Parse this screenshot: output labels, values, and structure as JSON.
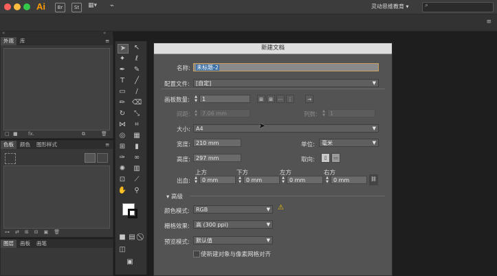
{
  "app": {
    "logo": "Ai",
    "toolbar_icons": [
      "Br",
      "St"
    ],
    "workspace": "灵动思维教育"
  },
  "panels": {
    "top_tabs": [
      "外观",
      "库"
    ],
    "top_footer_fx": "fx.",
    "middle_tabs": [
      "色板",
      "颜色",
      "图形样式"
    ],
    "bottom_tabs": [
      "图层",
      "画板",
      "画笔"
    ]
  },
  "dialog": {
    "title": "新建文档",
    "name_label": "名称:",
    "name_value": "未标题-2",
    "profile_label": "配置文件:",
    "profile_value": "[自定]",
    "artboards_label": "画板数量:",
    "artboards_value": "1",
    "spacing_label": "间距:",
    "spacing_value": "7.06 mm",
    "columns_label": "列数:",
    "columns_value": "1",
    "size_label": "大小:",
    "size_value": "A4",
    "width_label": "宽度:",
    "width_value": "210 mm",
    "units_label": "单位:",
    "units_value": "毫米",
    "height_label": "高度:",
    "height_value": "297 mm",
    "orientation_label": "取向:",
    "bleed_label": "出血:",
    "bleed_top_label": "上方",
    "bleed_top_value": "0 mm",
    "bleed_bottom_label": "下方",
    "bleed_bottom_value": "0 mm",
    "bleed_left_label": "左方",
    "bleed_left_value": "0 mm",
    "bleed_right_label": "右方",
    "bleed_right_value": "0 mm",
    "advanced_label": "高级",
    "color_mode_label": "颜色模式:",
    "color_mode_value": "RGB",
    "raster_label": "栅格效果:",
    "raster_value": "高 (300 ppi)",
    "preview_label": "预览模式:",
    "preview_value": "默认值",
    "align_pixel_label": "使新建对象与像素网格对齐"
  },
  "colors": {
    "accent_logo": "#ff9a00",
    "dialog_bg": "#535353",
    "warning": "#f2c200"
  }
}
